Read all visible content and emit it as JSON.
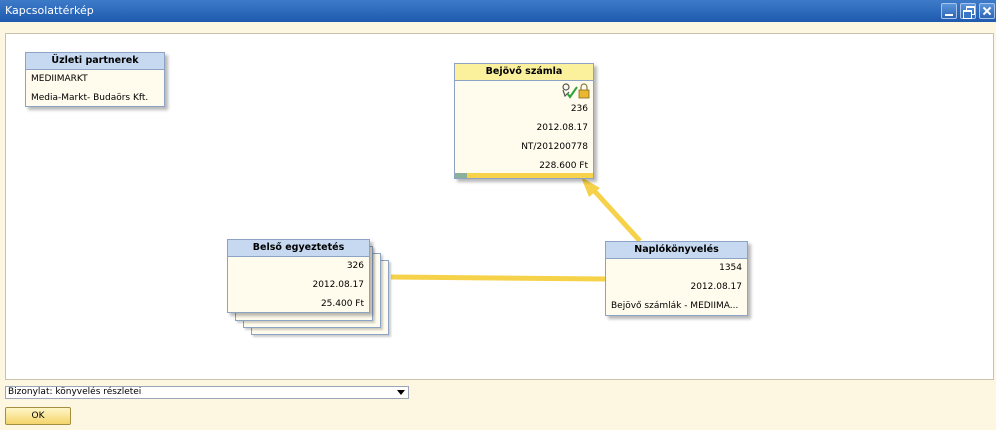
{
  "window": {
    "title": "Kapcsolattérkép"
  },
  "nodes": {
    "partner": {
      "title": "Üzleti partnerek",
      "code": "MEDIIMARKT",
      "name": "Media-Markt- Budaörs Kft."
    },
    "invoice": {
      "title": "Bejövő számla",
      "number": "236",
      "date": "2012.08.17",
      "reference": "NT/201200778",
      "amount": "228.600 Ft",
      "icons": [
        "approval-check-icon",
        "lock-icon"
      ],
      "progress": 0.09
    },
    "internal": {
      "title": "Belső egyeztetés",
      "number": "326",
      "date": "2012.08.17",
      "amount": "25.400 Ft"
    },
    "journal": {
      "title": "Naplókönyvelés",
      "number": "1354",
      "date": "2012.08.17",
      "remark": "Bejövő számlák - MEDIIMA..."
    }
  },
  "footer": {
    "document_select": "Bizonylat: könyvelés részletei",
    "ok_label": "OK"
  },
  "colors": {
    "connector": "#f6d24a",
    "header_blue": "#c6d9f0",
    "header_yellow": "#fbf09c",
    "titlebar": "#2a66b8"
  }
}
